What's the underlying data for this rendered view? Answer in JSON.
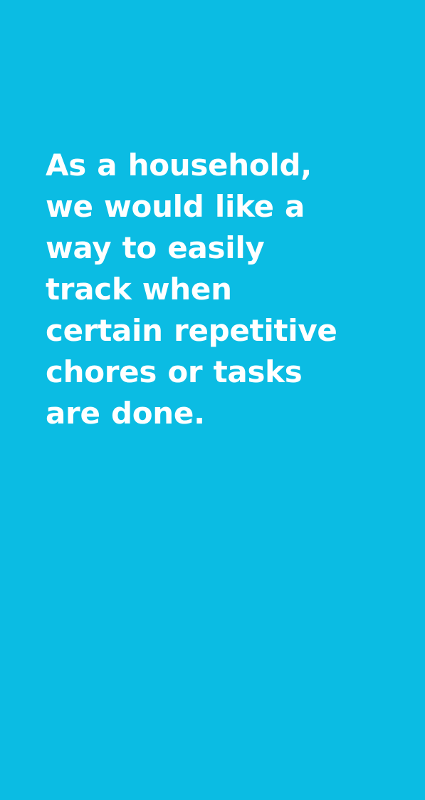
{
  "story": {
    "text": "As a household, we would like a way to easily track when certain repetitive chores or tasks are done."
  },
  "colors": {
    "background": "#0bbce3",
    "text": "#ffffff"
  }
}
